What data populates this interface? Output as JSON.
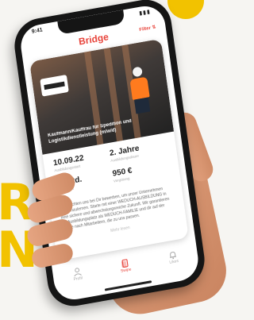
{
  "brand": {
    "accent": "#e8453c",
    "yellow": "#f2c200"
  },
  "background": {
    "letters": [
      "R",
      "N"
    ]
  },
  "status_bar": {
    "time": "9:41"
  },
  "app_bar": {
    "logo": "Bridge",
    "filter_label": "Filter ⇅"
  },
  "job_card": {
    "hero_title": "Kaufmann/Kauffrau für Spedition und Logistikdienstleistung (m/w/d)",
    "facts": [
      {
        "value": "10.09.22",
        "label": "Ausbildungsstart"
      },
      {
        "value": "2. Jahre",
        "label": "Ausbildungsdauer"
      },
      {
        "value": "38 Std.",
        "label": "Arbeitszeit"
      },
      {
        "value": "950 €",
        "label": "Vergütung"
      }
    ],
    "description": "Wir möchten uns bei Dir bewerben, um unser Unternehmen kennenzulernen. Starte mit einer WEDUCH-AUSBILDUNG in eine sichere und abwechslungsreiche Zukunft. Wir garantieren Dir Ausbildungsplatz als WEDUCH-FAMILIE und dir auf der Suche nach Mitarbeitern, die zu uns passen.",
    "more_label": "Mehr lesen"
  },
  "tab_bar": {
    "tabs": [
      {
        "label": "Profil",
        "icon": "person-icon"
      },
      {
        "label": "Swipe",
        "icon": "cards-icon"
      },
      {
        "label": "Likes",
        "icon": "bell-icon"
      }
    ]
  }
}
